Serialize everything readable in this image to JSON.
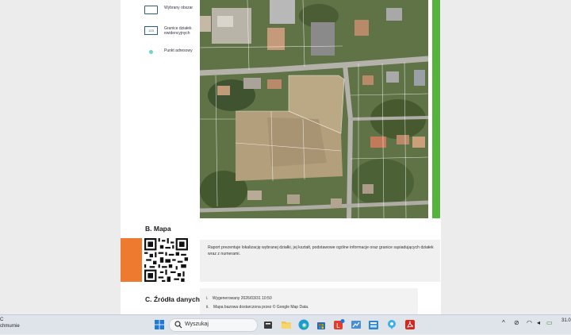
{
  "legend": {
    "selected_area": "Wybrany obszar",
    "parcel_boundaries": "Granice działek ewidencyjnych",
    "parcel_swatch_text": "123",
    "address_point": "Punkt adresowy"
  },
  "section_b": {
    "title": "B. Mapa",
    "description": "Raport prezentuje lokalizację wybranej działki, jej kształt, podstawowe ogólne informacje oraz granice sąsiadujących działek wraz z numerami."
  },
  "section_c": {
    "title": "C. Źródła danych",
    "items": [
      {
        "marker": "i.",
        "text": "Wygenerowany 2026/03/31 10:50"
      },
      {
        "marker": "ii.",
        "text": "Mapa bazowa dostarczona przez © Google Map Data."
      }
    ]
  },
  "taskbar": {
    "weather_temp": "C",
    "weather_desc": "chmurnie",
    "search_placeholder": "Wyszukaj",
    "clock": "31.0",
    "apps": [
      "windows-start",
      "search",
      "widgets",
      "file-explorer",
      "edge",
      "store",
      "lens",
      "onedrive",
      "settings",
      "photos",
      "acrobat"
    ]
  },
  "colors": {
    "accent_green": "#54b43c",
    "accent_orange": "#ee7a2f",
    "legend_blue": "#2a5e88",
    "address_dot": "#6fd4c9"
  }
}
